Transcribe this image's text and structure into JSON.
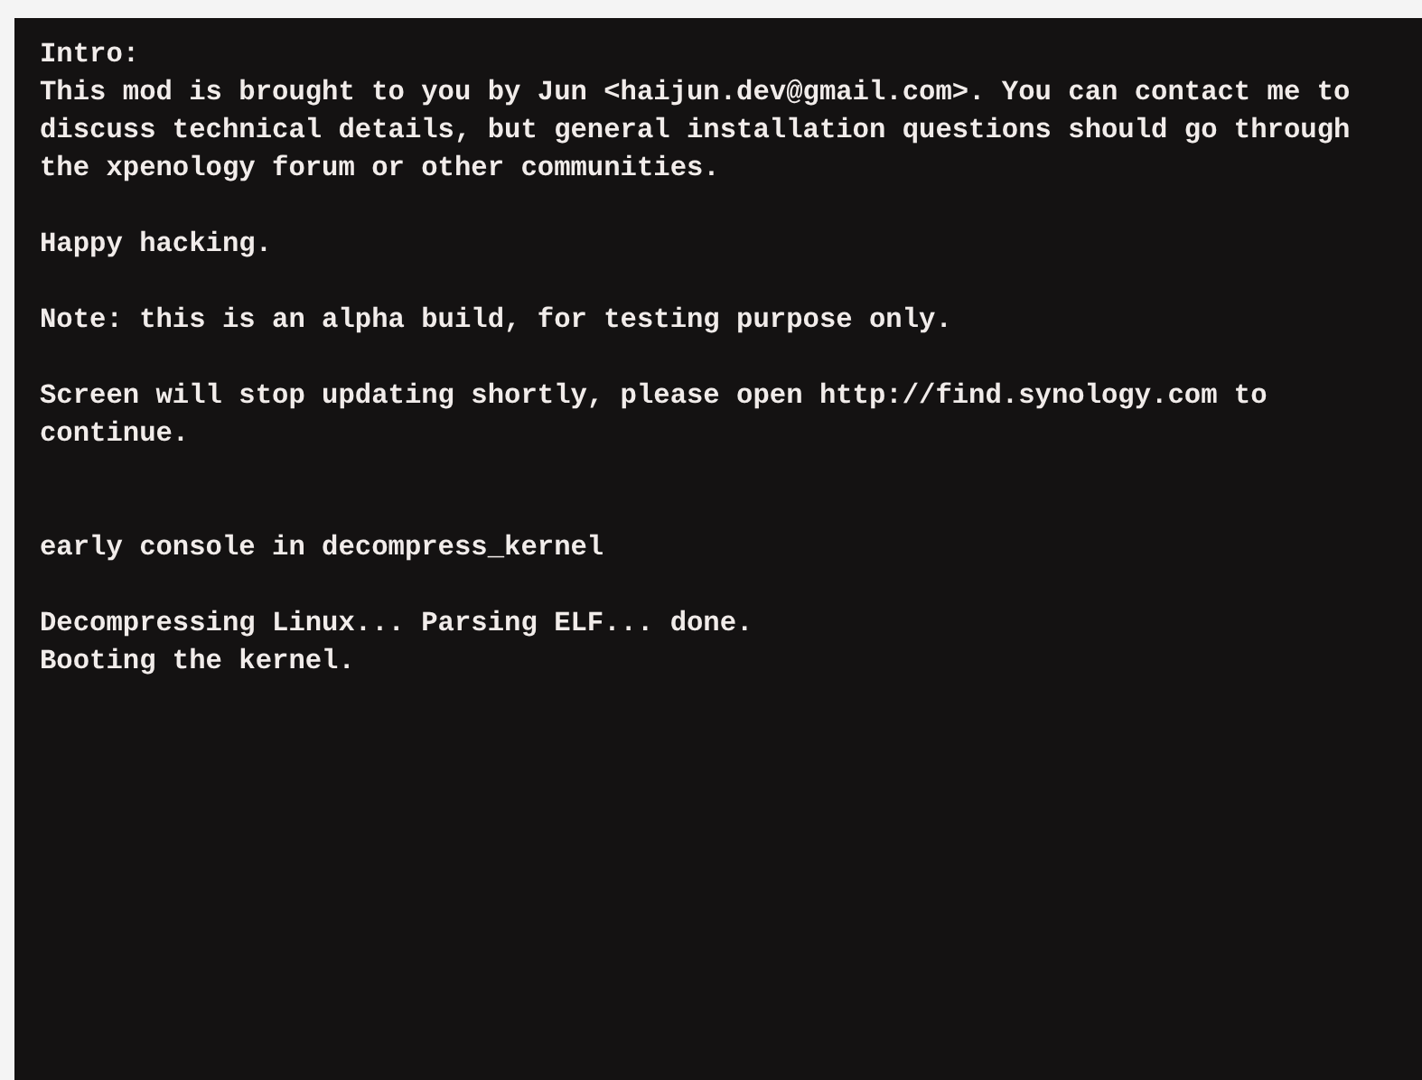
{
  "console": {
    "intro_messages": [
      {
        "lines": [
          "Intro:",
          "This mod is brought to you by Jun <haijun.dev@gmail.com>. You can contact me to",
          "discuss technical details, but general installation questions should go through",
          "the xpenology forum or other communities."
        ]
      },
      {
        "lines": [
          "Happy hacking."
        ]
      },
      {
        "lines": [
          "Note: this is an alpha build, for testing purpose only."
        ]
      },
      {
        "lines": [
          "Screen will stop updating shortly, please open http://find.synology.com to",
          "continue."
        ]
      }
    ],
    "kernel_messages": [
      {
        "lines": [
          "early console in decompress_kernel"
        ]
      },
      {
        "lines": [
          "Decompressing Linux... Parsing ELF... done.",
          "Booting the kernel."
        ]
      }
    ]
  }
}
